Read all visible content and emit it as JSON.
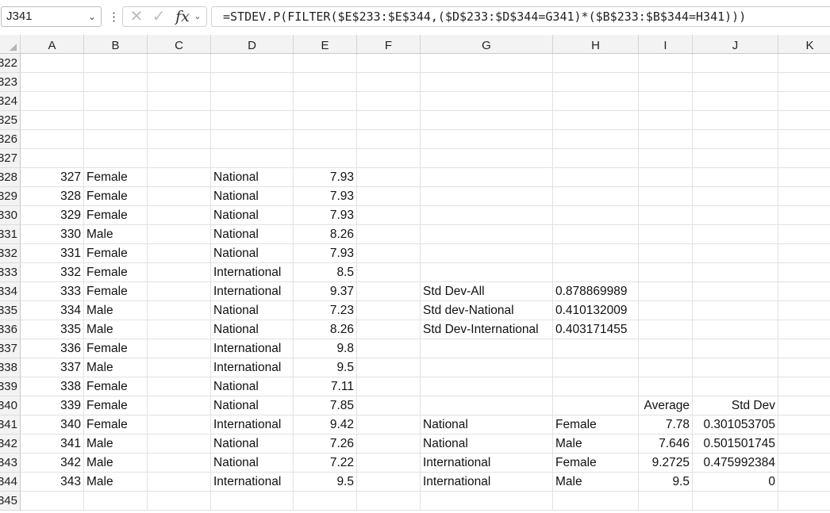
{
  "formula_bar": {
    "name_box": "J341",
    "formula": "=STDEV.P(FILTER($E$233:$E$344,($D$233:$D$344=G341)*($B$233:$B$344=H341)))"
  },
  "columns": [
    "A",
    "B",
    "C",
    "D",
    "E",
    "F",
    "G",
    "H",
    "I",
    "J",
    "K"
  ],
  "rows": [
    {
      "num": "322",
      "A": "",
      "B": "",
      "D": "",
      "E": "",
      "G": "",
      "H": "",
      "I": "",
      "J": ""
    },
    {
      "num": "323",
      "A": "",
      "B": "",
      "D": "",
      "E": "",
      "G": "",
      "H": "",
      "I": "",
      "J": ""
    },
    {
      "num": "324",
      "A": "",
      "B": "",
      "D": "",
      "E": "",
      "G": "",
      "H": "",
      "I": "",
      "J": ""
    },
    {
      "num": "325",
      "A": "",
      "B": "",
      "D": "",
      "E": "",
      "G": "",
      "H": "",
      "I": "",
      "J": ""
    },
    {
      "num": "326",
      "A": "",
      "B": "",
      "D": "",
      "E": "",
      "G": "",
      "H": "",
      "I": "",
      "J": ""
    },
    {
      "num": "327",
      "A": "",
      "B": "",
      "D": "",
      "E": "",
      "G": "",
      "H": "",
      "I": "",
      "J": ""
    },
    {
      "num": "328",
      "A": "327",
      "B": "Female",
      "D": "National",
      "E": "7.93",
      "G": "",
      "H": "",
      "I": "",
      "J": ""
    },
    {
      "num": "329",
      "A": "328",
      "B": "Female",
      "D": "National",
      "E": "7.93",
      "G": "",
      "H": "",
      "I": "",
      "J": ""
    },
    {
      "num": "330",
      "A": "329",
      "B": "Female",
      "D": "National",
      "E": "7.93",
      "G": "",
      "H": "",
      "I": "",
      "J": ""
    },
    {
      "num": "331",
      "A": "330",
      "B": "Male",
      "D": "National",
      "E": "8.26",
      "G": "",
      "H": "",
      "I": "",
      "J": ""
    },
    {
      "num": "332",
      "A": "331",
      "B": "Female",
      "D": "National",
      "E": "7.93",
      "G": "",
      "H": "",
      "I": "",
      "J": ""
    },
    {
      "num": "333",
      "A": "332",
      "B": "Female",
      "D": "International",
      "E": "8.5",
      "G": "",
      "H": "",
      "I": "",
      "J": ""
    },
    {
      "num": "334",
      "A": "333",
      "B": "Female",
      "D": "International",
      "E": "9.37",
      "G": "Std Dev-All",
      "H": "0.878869989",
      "I": "",
      "J": ""
    },
    {
      "num": "335",
      "A": "334",
      "B": "Male",
      "D": "National",
      "E": "7.23",
      "G": "Std dev-National",
      "H": "0.410132009",
      "I": "",
      "J": ""
    },
    {
      "num": "336",
      "A": "335",
      "B": "Male",
      "D": "National",
      "E": "8.26",
      "G": "Std Dev-International",
      "H": "0.403171455",
      "I": "",
      "J": ""
    },
    {
      "num": "337",
      "A": "336",
      "B": "Female",
      "D": "International",
      "E": "9.8",
      "G": "",
      "H": "",
      "I": "",
      "J": ""
    },
    {
      "num": "338",
      "A": "337",
      "B": "Male",
      "D": "International",
      "E": "9.5",
      "G": "",
      "H": "",
      "I": "",
      "J": ""
    },
    {
      "num": "339",
      "A": "338",
      "B": "Female",
      "D": "National",
      "E": "7.11",
      "G": "",
      "H": "",
      "I": "",
      "J": ""
    },
    {
      "num": "340",
      "A": "339",
      "B": "Female",
      "D": "National",
      "E": "7.85",
      "G": "",
      "H": "",
      "I": "Average",
      "J": "Std Dev"
    },
    {
      "num": "341",
      "A": "340",
      "B": "Female",
      "D": "International",
      "E": "9.42",
      "G": "National",
      "H": "Female",
      "I": "7.78",
      "J": "0.301053705"
    },
    {
      "num": "342",
      "A": "341",
      "B": "Male",
      "D": "National",
      "E": "7.26",
      "G": "National",
      "H": "Male",
      "I": "7.646",
      "J": "0.501501745"
    },
    {
      "num": "343",
      "A": "342",
      "B": "Male",
      "D": "National",
      "E": "7.22",
      "G": "International",
      "H": "Female",
      "I": "9.2725",
      "J": "0.475992384"
    },
    {
      "num": "344",
      "A": "343",
      "B": "Male",
      "D": "International",
      "E": "9.5",
      "G": "International",
      "H": "Male",
      "I": "9.5",
      "J": "0"
    },
    {
      "num": "345",
      "A": "",
      "B": "",
      "D": "",
      "E": "",
      "G": "",
      "H": "",
      "I": "",
      "J": ""
    }
  ]
}
